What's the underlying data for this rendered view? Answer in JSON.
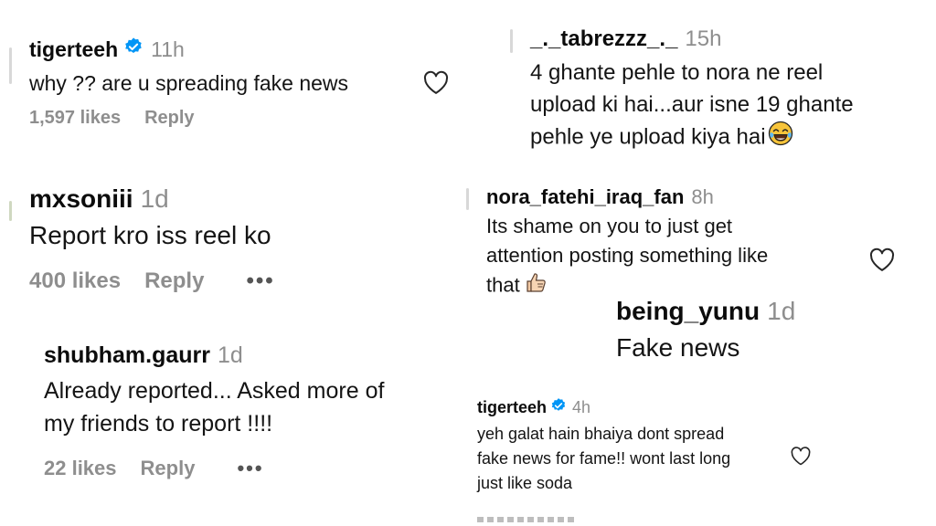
{
  "comments": [
    {
      "username": "tigerteeh",
      "time": "11h",
      "text_lines": [
        "why ?? are u spreading fake news"
      ],
      "likes": "1,597 likes",
      "reply": "Reply"
    },
    {
      "username": "mxsoniii",
      "time": "1d",
      "text_lines": [
        "Report kro iss reel ko"
      ],
      "likes": "400 likes",
      "reply": "Reply",
      "more": "•••"
    },
    {
      "username": "shubham.gaurr",
      "time": "1d",
      "text_lines": [
        "Already reported... Asked more of",
        "my friends to report !!!!"
      ],
      "likes": "22 likes",
      "reply": "Reply",
      "more": "•••"
    },
    {
      "username": "_._tabrezzz_._",
      "time": "15h",
      "text_lines": [
        "4 ghante pehle to nora ne reel",
        "upload ki hai...aur isne 19 ghante",
        "pehle ye upload kiya hai"
      ]
    },
    {
      "username": "nora_fatehi_iraq_fan",
      "time": "8h",
      "text_lines": [
        "Its shame on you to just get",
        "attention posting something like",
        "that"
      ]
    },
    {
      "username": "being_yunu",
      "time": "1d",
      "text_lines": [
        "Fake news"
      ]
    },
    {
      "username": "tigerteeh",
      "time": "4h",
      "text_lines": [
        "yeh galat hain bhaiya dont spread",
        "fake news for fame!! wont last long",
        "just like soda"
      ]
    }
  ],
  "icons": {
    "verified": "verified-badge-icon",
    "heart": "heart-outline-icon",
    "emoji_laugh": "tears-of-joy-emoji",
    "emoji_thumb": "thumbs-up-emoji"
  },
  "colors": {
    "verified_blue": "#0095f6",
    "muted_gray": "#8e8e8e"
  }
}
